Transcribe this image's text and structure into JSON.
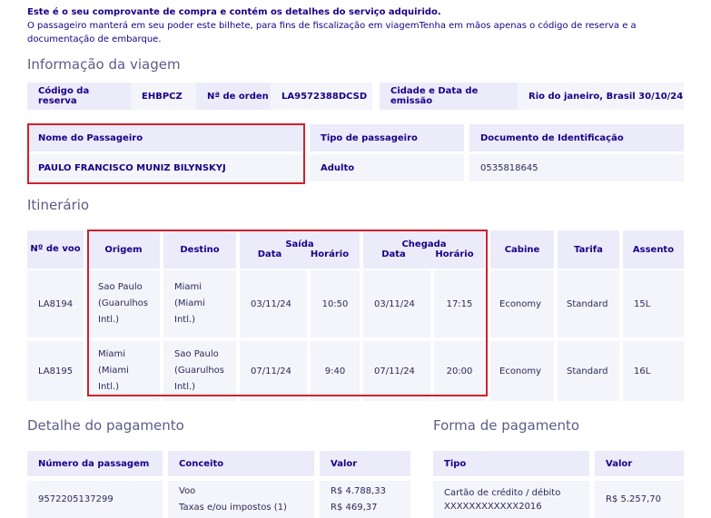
{
  "intro": {
    "line1": "Este é o seu comprovante de compra e contém os detalhes do serviço adquirido.",
    "line2": "O passageiro manterá em seu poder este bilhete, para fins de fiscalização em viagemTenha em mãos apenas o código de reserva e a documentação de embarque."
  },
  "trip": {
    "title": "Informação da viagem",
    "reserva_label": "Código da reserva",
    "reserva_value": "EHBPCZ",
    "ordem_label": "Nª de orden",
    "ordem_value": "LA9572388DCSD",
    "cidade_label": "Cidade e Data de emissão",
    "cidade_value": "Rio do janeiro, Brasil 30/10/24",
    "nome_label": "Nome do Passageiro",
    "nome_value": "PAULO FRANCISCO MUNIZ BILYNSKYJ",
    "tipo_label": "Tipo de passageiro",
    "tipo_value": "Adulto",
    "doc_label": "Documento de Identificação",
    "doc_value": "0535818645"
  },
  "itinerary": {
    "title": "Itinerário",
    "headers": {
      "voo": "Nº de voo",
      "origem": "Origem",
      "destino": "Destino",
      "saida": "Saída",
      "chegada": "Chegada",
      "data": "Data",
      "horario": "Horário",
      "cabine": "Cabine",
      "tarifa": "Tarifa",
      "assento": "Assento"
    },
    "rows": [
      {
        "voo": "LA8194",
        "origem": [
          "Sao Paulo",
          "(Guarulhos",
          "Intl.)"
        ],
        "destino": [
          "Miami",
          "(Miami",
          "Intl.)"
        ],
        "saida_data": "03/11/24",
        "saida_hora": "10:50",
        "chegada_data": "03/11/24",
        "chegada_hora": "17:15",
        "cabine": "Economy",
        "tarifa": "Standard",
        "assento": "15L"
      },
      {
        "voo": "LA8195",
        "origem": [
          "Miami",
          "(Miami",
          "Intl.)"
        ],
        "destino": [
          "Sao Paulo",
          "(Guarulhos",
          "Intl.)"
        ],
        "saida_data": "07/11/24",
        "saida_hora": "9:40",
        "chegada_data": "07/11/24",
        "chegada_hora": "20:00",
        "cabine": "Economy",
        "tarifa": "Standard",
        "assento": "16L"
      }
    ]
  },
  "payment_detail": {
    "title": "Detalhe do pagamento",
    "h_numero": "Número da passagem",
    "h_conceito": "Conceito",
    "h_valor": "Valor",
    "numero": "9572205137299",
    "conceito": [
      "Voo",
      "Taxas e/ou impostos (1)"
    ],
    "valor": [
      "R$ 4.788,33",
      "R$ 469,37"
    ]
  },
  "payment_form": {
    "title": "Forma de pagamento",
    "h_tipo": "Tipo",
    "h_valor": "Valor",
    "tipo": [
      "Cartão de crédito / débito",
      "XXXXXXXXXXXX2016"
    ],
    "valor": "R$ 5.257,70"
  }
}
